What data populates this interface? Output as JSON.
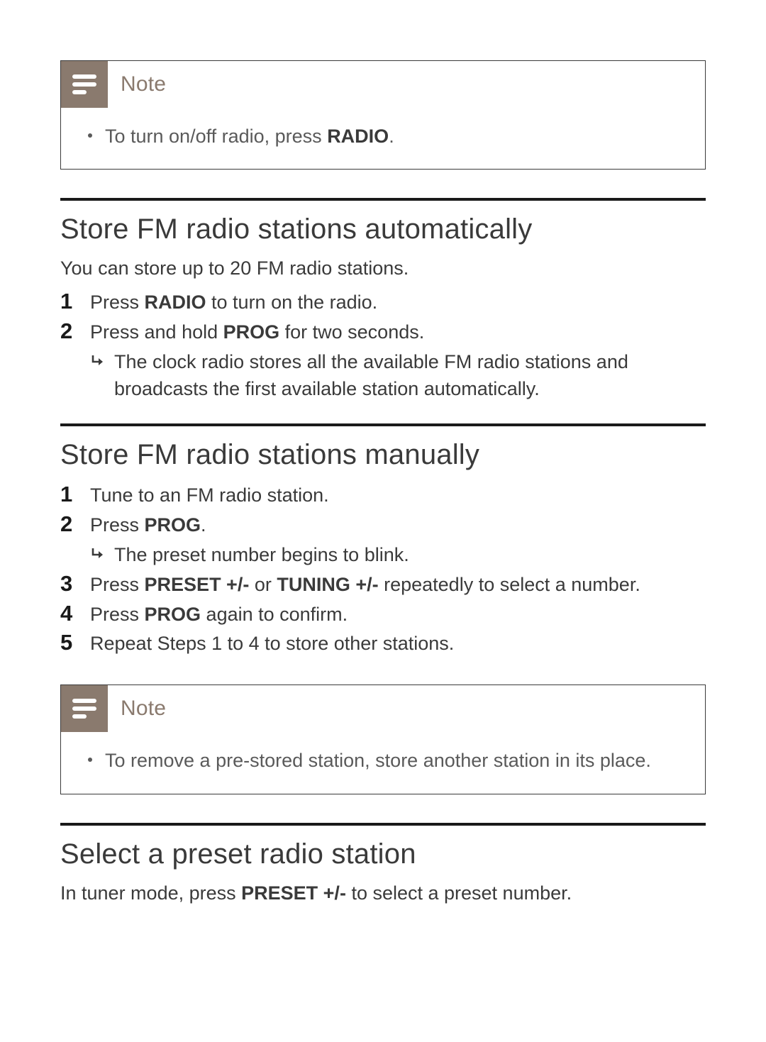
{
  "note1": {
    "label": "Note",
    "bullet_pre": "To turn on/off radio, press ",
    "bullet_bold": "RADIO",
    "bullet_post": "."
  },
  "sec_auto": {
    "title": "Store FM radio stations automatically",
    "intro": "You can store up to 20 FM radio stations.",
    "step1_num": "1",
    "step1_pre": "Press ",
    "step1_bold": "RADIO",
    "step1_post": " to turn on the radio.",
    "step2_num": "2",
    "step2_pre": "Press and hold ",
    "step2_bold": "PROG",
    "step2_post": " for two seconds.",
    "step2_sub": "The clock radio stores all the available FM radio stations and broadcasts the first available station automatically."
  },
  "sec_manual": {
    "title": "Store FM radio stations manually",
    "step1_num": "1",
    "step1_text": "Tune to an FM radio station.",
    "step2_num": "2",
    "step2_pre": "Press ",
    "step2_bold": "PROG",
    "step2_post": ".",
    "step2_sub": "The preset number begins to blink.",
    "step3_num": "3",
    "step3_pre": "Press ",
    "step3_bold1": "PRESET +/-",
    "step3_mid": " or ",
    "step3_bold2": "TUNING +/-",
    "step3_post": " repeatedly to select a number.",
    "step4_num": "4",
    "step4_pre": "Press ",
    "step4_bold": "PROG",
    "step4_post": " again to confirm.",
    "step5_num": "5",
    "step5_text": "Repeat Steps 1 to 4 to store other stations."
  },
  "note2": {
    "label": "Note",
    "bullet": "To remove a pre-stored station, store another station in its place."
  },
  "sec_select": {
    "title": "Select a preset radio station",
    "intro_pre": "In tuner mode, press ",
    "intro_bold": "PRESET +/-",
    "intro_post": " to select a preset number."
  }
}
